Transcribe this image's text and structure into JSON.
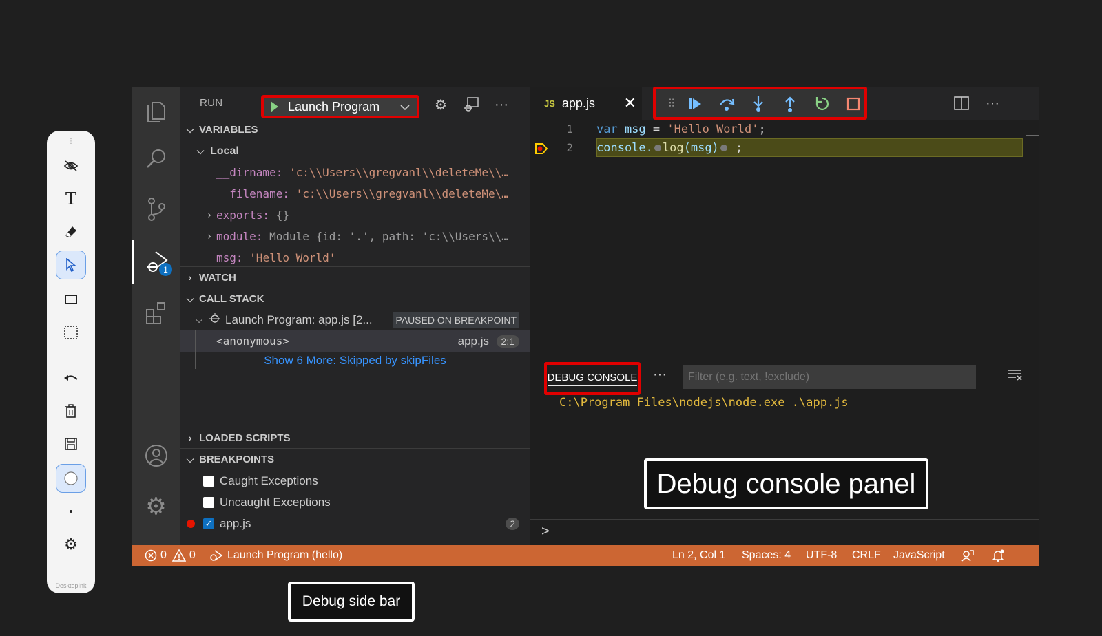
{
  "desktop_toolbar": {
    "brand": "DesktopInk",
    "tools": [
      {
        "name": "hide-icon"
      },
      {
        "name": "text-tool-icon",
        "label": "T"
      },
      {
        "name": "eraser-icon"
      },
      {
        "name": "pointer-icon"
      },
      {
        "name": "rectangle-icon"
      },
      {
        "name": "selection-icon"
      },
      {
        "name": "undo-icon"
      },
      {
        "name": "trash-icon"
      },
      {
        "name": "save-icon"
      },
      {
        "name": "circle-icon"
      },
      {
        "name": "dot-icon"
      },
      {
        "name": "settings-icon"
      }
    ]
  },
  "sidebar": {
    "header": "RUN",
    "launch_config": "Launch Program",
    "variables": {
      "title": "VARIABLES",
      "scope": "Local",
      "items": [
        {
          "name": "__dirname:",
          "value": "'c:\\\\Users\\\\gregvanl\\\\deleteMe\\\\…"
        },
        {
          "name": "__filename:",
          "value": "'c:\\\\Users\\\\gregvanl\\\\deleteMe\\…"
        },
        {
          "name": "exports:",
          "value": "{}"
        },
        {
          "name": "module:",
          "value": "Module {id: '.', path: 'c:\\\\Users\\\\…"
        },
        {
          "name": "msg:",
          "value": "'Hello World'"
        }
      ]
    },
    "watch_title": "WATCH",
    "call_stack": {
      "title": "CALL STACK",
      "session": "Launch Program: app.js [2...",
      "status": "PAUSED ON BREAKPOINT",
      "frame": "<anonymous>",
      "frame_file": "app.js",
      "frame_pos": "2:1",
      "skipped": "Show 6 More: Skipped by skipFiles"
    },
    "loaded_scripts_title": "LOADED SCRIPTS",
    "breakpoints": {
      "title": "BREAKPOINTS",
      "items": [
        {
          "label": "Caught Exceptions",
          "checked": false
        },
        {
          "label": "Uncaught Exceptions",
          "checked": false
        },
        {
          "label": "app.js",
          "checked": true,
          "count": "2"
        }
      ]
    }
  },
  "activity_bar": {
    "run_badge": "1"
  },
  "editor": {
    "tab_prefix": "JS",
    "tab_name": "app.js",
    "lines": [
      {
        "num": "1"
      },
      {
        "num": "2"
      }
    ],
    "code": {
      "l1_kw": "var",
      "l1_id": " msg ",
      "l1_eq": "= ",
      "l1_str": "'Hello World'",
      "l1_end": ";",
      "l2_obj": "console.",
      "l2_fn": "log",
      "l2_arg": "(msg)",
      "l2_end": " ;"
    }
  },
  "panel": {
    "tab": "DEBUG CONSOLE",
    "filter_placeholder": "Filter (e.g. text, !exclude)",
    "output_cmd": "C:\\Program Files\\nodejs\\node.exe ",
    "output_link": ".\\app.js",
    "prompt": ">"
  },
  "status_bar": {
    "errors": "0",
    "warnings": "0",
    "session": "Launch Program (hello)",
    "position": "Ln 2, Col 1",
    "spaces": "Spaces: 4",
    "encoding": "UTF-8",
    "eol": "CRLF",
    "language": "JavaScript"
  },
  "callouts": {
    "console": "Debug console panel",
    "sidebar": "Debug side bar"
  },
  "colors": {
    "status_bar": "#cc6633",
    "highlight_red": "#e00000",
    "debug_blue": "#75beff",
    "continue_green": "#89d185"
  }
}
